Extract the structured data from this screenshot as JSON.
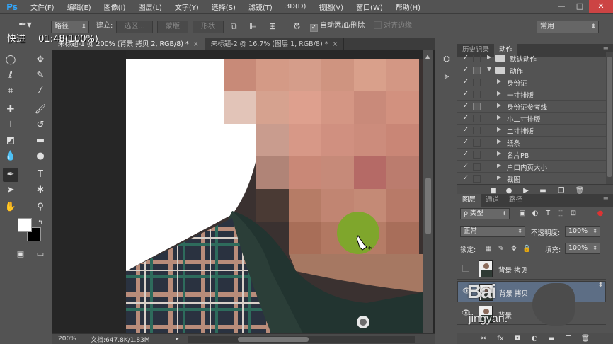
{
  "app": {
    "logo": "Ps",
    "menu": [
      "文件(F)",
      "编辑(E)",
      "图像(I)",
      "图层(L)",
      "文字(Y)",
      "选择(S)",
      "滤镜(T)",
      "3D(D)",
      "视图(V)",
      "窗口(W)",
      "帮助(H)"
    ],
    "window_controls": [
      "—",
      "□",
      "✕"
    ]
  },
  "options_bar": {
    "tool_mode": "路径",
    "make_label": "建立:",
    "selection_btn": "选区...",
    "mask_btn": "蒙版",
    "shape_btn": "形状",
    "auto_add_delete": "自动添加/删除",
    "align_edges": "对齐边缘",
    "workspace": "常用"
  },
  "overlay": {
    "speed": "快进",
    "time": "01:48(100%)"
  },
  "doc_tabs": [
    {
      "label": "未标题-1 @ 200% (背景 拷贝 2, RGB/8) *",
      "close": "×",
      "active": true
    },
    {
      "label": "未标题-2 @ 16.7% (图层 1, RGB/8) *",
      "close": "×",
      "active": false
    }
  ],
  "toolbox": {
    "icons": [
      "marquee-icon",
      "lasso-icon",
      "quick-select-icon",
      "crop-icon",
      "eyedropper-icon",
      "healing-brush-icon",
      "brush-icon",
      "clone-stamp-icon",
      "history-brush-icon",
      "eraser-icon",
      "gradient-icon",
      "blur-icon",
      "dodge-icon",
      "pen-icon",
      "type-icon",
      "path-select-icon",
      "shape-icon",
      "hand-icon",
      "zoom-icon"
    ]
  },
  "status": {
    "zoom": "200%",
    "doc_info": "文档:647.8K/1.83M"
  },
  "history_actions_panel": {
    "tabs": [
      "历史记录",
      "动作"
    ],
    "active_tab": "动作",
    "rows": [
      {
        "label": "默认动作",
        "checked": true,
        "dialog": false,
        "twirl": "▶",
        "type": "set"
      },
      {
        "label": "动作",
        "checked": true,
        "dialog": true,
        "twirl": "▼",
        "type": "set"
      },
      {
        "label": "身份证",
        "checked": true,
        "dialog": false,
        "twirl": "▶",
        "type": "action"
      },
      {
        "label": "一寸排版",
        "checked": true,
        "dialog": false,
        "twirl": "▶",
        "type": "action"
      },
      {
        "label": "身份证参考线",
        "checked": true,
        "dialog": true,
        "twirl": "▶",
        "type": "action"
      },
      {
        "label": "小二寸排版",
        "checked": true,
        "dialog": false,
        "twirl": "▶",
        "type": "action"
      },
      {
        "label": "二寸排版",
        "checked": true,
        "dialog": false,
        "twirl": "▶",
        "type": "action"
      },
      {
        "label": "纸条",
        "checked": true,
        "dialog": false,
        "twirl": "▶",
        "type": "action"
      },
      {
        "label": "名片PB",
        "checked": true,
        "dialog": false,
        "twirl": "▶",
        "type": "action"
      },
      {
        "label": "户口内页大小",
        "checked": true,
        "dialog": false,
        "twirl": "▶",
        "type": "action"
      },
      {
        "label": "裁图",
        "checked": true,
        "dialog": false,
        "twirl": "▶",
        "type": "action"
      }
    ]
  },
  "layers_panel": {
    "tabs": [
      "图层",
      "通道",
      "路径"
    ],
    "active_tab": "图层",
    "filter_label": "ρ 类型",
    "blend_mode": "正常",
    "opacity_label": "不透明度:",
    "opacity_value": "100%",
    "lock_label": "锁定:",
    "fill_label": "填充:",
    "fill_value": "100%",
    "layers": [
      {
        "name": "背景 拷贝",
        "visible": false,
        "selected": false
      },
      {
        "name": "背景 拷贝",
        "visible": true,
        "selected": true
      },
      {
        "name": "背景",
        "visible": true,
        "selected": false
      }
    ]
  },
  "watermark": {
    "big": "Bai",
    "small": "jingyan."
  },
  "colors": {
    "accent": "#31a8ff",
    "panel_bg": "#535353",
    "selected_layer": "#5d6e85",
    "green_dot": "#7fa62c"
  }
}
